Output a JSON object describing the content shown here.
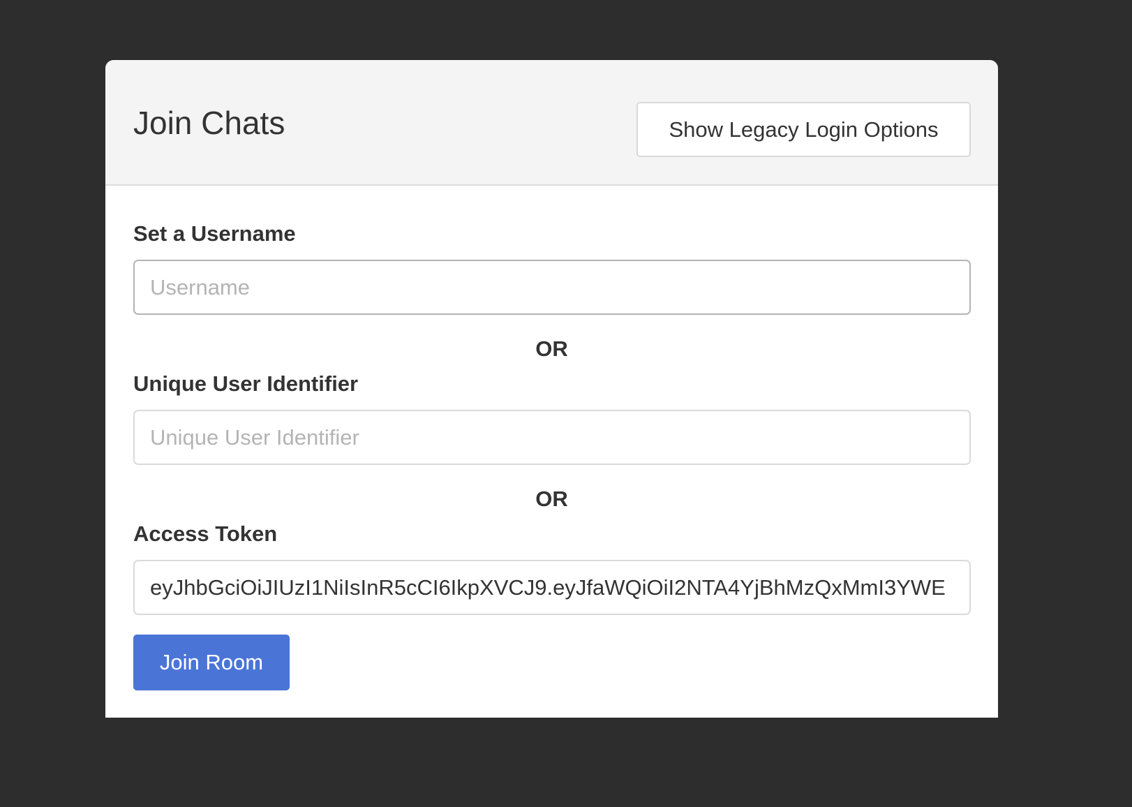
{
  "header": {
    "title": "Join Chats",
    "legacy_button_label": "Show Legacy Login Options"
  },
  "form": {
    "username": {
      "label": "Set a Username",
      "placeholder": "Username",
      "value": ""
    },
    "separator_1": "OR",
    "unique_id": {
      "label": "Unique User Identifier",
      "placeholder": "Unique User Identifier",
      "value": ""
    },
    "separator_2": "OR",
    "access_token": {
      "label": "Access Token",
      "placeholder": "",
      "value": "eyJhbGciOiJIUzI1NiIsInR5cCI6IkpXVCJ9.eyJfaWQiOiI2NTA4YjBhMzQxMmI3YWE"
    },
    "submit_label": "Join Room"
  },
  "colors": {
    "page_background": "#2d2d2d",
    "card_header_background": "#f4f4f4",
    "primary_button": "#4a74d6"
  }
}
